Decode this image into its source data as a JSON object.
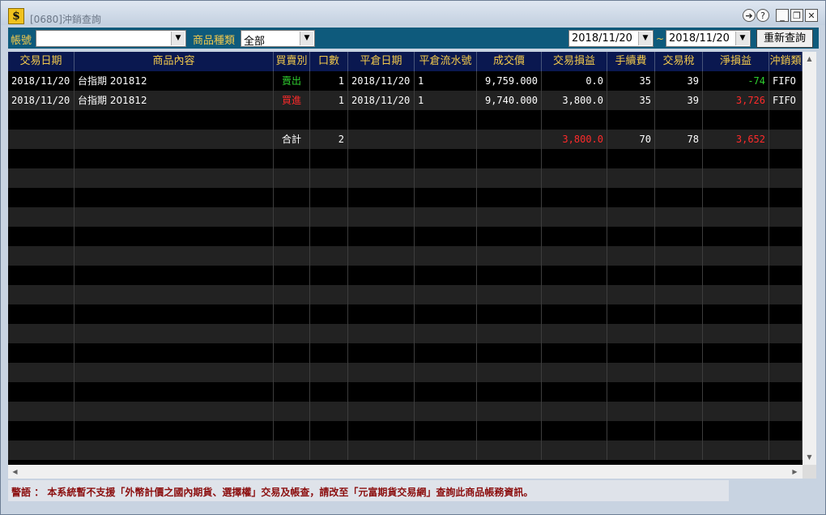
{
  "window": {
    "title": "[0680]沖銷查詢",
    "app_icon": "$"
  },
  "toolbar": {
    "account_label": "帳號",
    "account_value": "",
    "product_type_label": "商品種類",
    "product_type_value": "全部",
    "date_from": "2018/11/20",
    "date_tilde": "~",
    "date_to": "2018/11/20",
    "requery_label": "重新查詢"
  },
  "table": {
    "columns": [
      "交易日期",
      "商品內容",
      "買賣別",
      "口數",
      "平倉日期",
      "平倉流水號",
      "成交價",
      "交易損益",
      "手續費",
      "交易稅",
      "淨損益",
      "沖銷類"
    ],
    "rows": [
      {
        "trade_date": "2018/11/20",
        "product": "台指期 201812",
        "side": "賣出",
        "qty": "1",
        "close_date": "2018/11/20",
        "close_serial": "1",
        "price": "9,759.000",
        "trade_pl": "0.0",
        "fee": "35",
        "tax": "39",
        "net_pl": "-74",
        "method": "FIFO"
      },
      {
        "trade_date": "2018/11/20",
        "product": "台指期 201812",
        "side": "買進",
        "qty": "1",
        "close_date": "2018/11/20",
        "close_serial": "1",
        "price": "9,740.000",
        "trade_pl": "3,800.0",
        "fee": "35",
        "tax": "39",
        "net_pl": "3,726",
        "method": "FIFO"
      }
    ],
    "total": {
      "label": "合計",
      "qty": "2",
      "trade_pl": "3,800.0",
      "fee": "70",
      "tax": "78",
      "net_pl": "3,652"
    }
  },
  "colors": {
    "sell": "#2fd02f",
    "buy": "#ff2a2a",
    "loss": "#2fd02f",
    "profit": "#ff2a2a",
    "header_text": "#f2c94c",
    "toolbar_bg": "#0e5a7c"
  },
  "footer": {
    "warning": "警語 ： 本系統暫不支援「外幣計價之國內期貨、選擇權」交易及帳查，請改至「元富期貨交易網」查詢此商品帳務資訊。"
  },
  "icons": [
    "app-dollar-icon",
    "transfer-icon",
    "help-icon",
    "minimize-icon",
    "maximize-icon",
    "close-icon",
    "chevron-down-icon",
    "scroll-up-icon",
    "scroll-down-icon",
    "scroll-left-icon",
    "scroll-right-icon"
  ]
}
